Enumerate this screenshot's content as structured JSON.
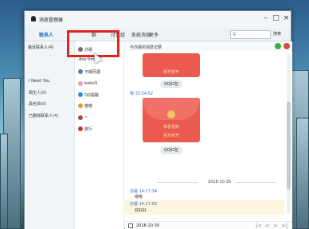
{
  "window": {
    "title": "消息管理器",
    "min": "–",
    "max": "□",
    "close": "×"
  },
  "toolbar": {
    "tabs": [
      "联系人",
      "群",
      "讨论组",
      "系统消息",
      "更多"
    ],
    "search_scope": "搜索"
  },
  "left": {
    "header": "最近联系人(4)",
    "categories": [
      "I Need You",
      "陌生人(0)",
      "黑名单(0)",
      "已删除联系人(4)"
    ]
  },
  "middle": {
    "header": "Any time",
    "contacts": [
      {
        "name": "亦晨",
        "color": "#7a6a5e"
      },
      {
        "name": "不期而遇",
        "color": "#5b7fa8"
      },
      {
        "name": "babyQ",
        "color": "#e7a1b0"
      },
      {
        "name": "QQ提醒",
        "color": "#2d8ce0"
      },
      {
        "name": "橙橙",
        "color": "#f09a2e"
      },
      {
        "name": "~",
        "color": "#a0552f"
      },
      {
        "name": "旅行",
        "color": "#c03a3a"
      }
    ]
  },
  "chat": {
    "header": "与亦晨的消息记录",
    "envelope1_text": "拆开拆开",
    "tag1": "QQ红包",
    "ts1": "我 22:24:52",
    "envelope2_title": "恭喜发财",
    "envelope2_sub": "拆开拆开",
    "tag2": "QQ红包",
    "date_sep": "2018-10-30",
    "ts2": "亦晨 14:17:34",
    "msg2": "嗯嗯",
    "ts3": "亦晨 14:17:56",
    "msg3": "欢好好",
    "bottom_date": "2018-10-30",
    "nav": [
      "|<",
      "<",
      ">",
      ">|"
    ]
  }
}
